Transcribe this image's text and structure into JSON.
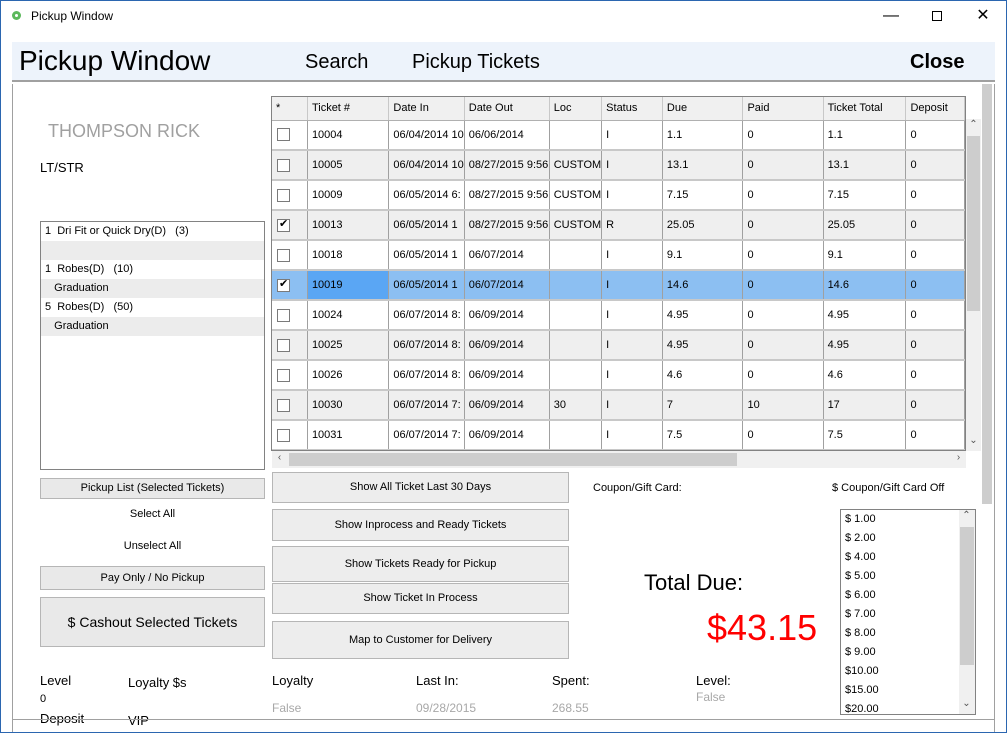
{
  "window": {
    "title": "Pickup Window",
    "controls": {
      "minimize": "—",
      "close": "✕"
    }
  },
  "header": {
    "title": "Pickup Window",
    "nav": {
      "search": "Search",
      "pickup_tickets": "Pickup Tickets",
      "close": "Close"
    }
  },
  "customer": {
    "name": "THOMPSON RICK",
    "type": "LT/STR"
  },
  "items": [
    {
      "text": "1  Dri Fit or Quick Dry(D)   (3)",
      "alt": false
    },
    {
      "text": "",
      "alt": true
    },
    {
      "text": "1  Robes(D)   (10)",
      "alt": false
    },
    {
      "text": "   Graduation",
      "alt": true
    },
    {
      "text": "5  Robes(D)   (50)",
      "alt": false
    },
    {
      "text": "   Graduation",
      "alt": true
    }
  ],
  "left_actions": {
    "pickup_list": "Pickup List (Selected Tickets)",
    "select_all": "Select All",
    "unselect_all": "Unselect All",
    "pay_only": "Pay Only / No Pickup",
    "cashout": "$ Cashout Selected Tickets"
  },
  "stats": {
    "level_label": "Level",
    "level_value": "0",
    "loyalty_dollars_label": "Loyalty $s",
    "deposit_label": "Deposit",
    "vip_label": "VIP",
    "loyalty_label": "Loyalty",
    "loyalty_value": "False",
    "last_in_label": "Last In:",
    "last_in_value": "09/28/2015",
    "spent_label": "Spent:",
    "spent_value": "268.55",
    "level2_label": "Level:",
    "level2_value": "False"
  },
  "tickets": {
    "columns": [
      "*",
      "Ticket #",
      "Date In",
      "Date Out",
      "Loc",
      "Status",
      "Due",
      "Paid",
      "Ticket Total",
      "Deposit"
    ],
    "rows": [
      {
        "checked": false,
        "ticket": "10004",
        "date_in": "06/04/2014 10",
        "date_out": "06/06/2014",
        "loc": "",
        "status": "I",
        "due": "1.1",
        "paid": "0",
        "total": "1.1",
        "deposit": "0"
      },
      {
        "checked": false,
        "ticket": "10005",
        "date_in": "06/04/2014 10",
        "date_out": "08/27/2015 9:56",
        "loc": "CUSTOM",
        "status": "I",
        "due": "13.1",
        "paid": "0",
        "total": "13.1",
        "deposit": "0"
      },
      {
        "checked": false,
        "ticket": "10009",
        "date_in": "06/05/2014 6:",
        "date_out": "08/27/2015 9:56",
        "loc": "CUSTOM",
        "status": "I",
        "due": "7.15",
        "paid": "0",
        "total": "7.15",
        "deposit": "0"
      },
      {
        "checked": true,
        "ticket": "10013",
        "date_in": "06/05/2014 1",
        "date_out": "08/27/2015 9:56",
        "loc": "CUSTOM",
        "status": "R",
        "due": "25.05",
        "paid": "0",
        "total": "25.05",
        "deposit": "0"
      },
      {
        "checked": false,
        "ticket": "10018",
        "date_in": "06/05/2014 1",
        "date_out": "06/07/2014",
        "loc": "",
        "status": "I",
        "due": "9.1",
        "paid": "0",
        "total": "9.1",
        "deposit": "0"
      },
      {
        "checked": true,
        "ticket": "10019",
        "date_in": "06/05/2014 1",
        "date_out": "06/07/2014",
        "loc": "",
        "status": "I",
        "due": "14.6",
        "paid": "0",
        "total": "14.6",
        "deposit": "0",
        "selected": true
      },
      {
        "checked": false,
        "ticket": "10024",
        "date_in": "06/07/2014 8:",
        "date_out": "06/09/2014",
        "loc": "",
        "status": "I",
        "due": "4.95",
        "paid": "0",
        "total": "4.95",
        "deposit": "0"
      },
      {
        "checked": false,
        "ticket": "10025",
        "date_in": "06/07/2014 8:",
        "date_out": "06/09/2014",
        "loc": "",
        "status": "I",
        "due": "4.95",
        "paid": "0",
        "total": "4.95",
        "deposit": "0"
      },
      {
        "checked": false,
        "ticket": "10026",
        "date_in": "06/07/2014 8:",
        "date_out": "06/09/2014",
        "loc": "",
        "status": "I",
        "due": "4.6",
        "paid": "0",
        "total": "4.6",
        "deposit": "0"
      },
      {
        "checked": false,
        "ticket": "10030",
        "date_in": "06/07/2014 7:",
        "date_out": "06/09/2014",
        "loc": "30",
        "status": "I",
        "due": "7",
        "paid": "10",
        "total": "17",
        "deposit": "0"
      },
      {
        "checked": false,
        "ticket": "10031",
        "date_in": "06/07/2014 7:",
        "date_out": "06/09/2014",
        "loc": "",
        "status": "I",
        "due": "7.5",
        "paid": "0",
        "total": "7.5",
        "deposit": "0"
      }
    ]
  },
  "filter_buttons": {
    "last30": "Show All Ticket Last 30 Days",
    "inprocess_ready": "Show Inprocess and Ready Tickets",
    "ready": "Show Tickets Ready for Pickup",
    "inprocess": "Show Ticket In Process",
    "map_delivery": "Map to Customer for Delivery"
  },
  "coupon": {
    "label": "Coupon/Gift Card:",
    "off_label": "$ Coupon/Gift Card Off",
    "options": [
      "$ 1.00",
      "$ 2.00",
      "$ 4.00",
      "$ 5.00",
      "$ 6.00",
      "$ 7.00",
      "$ 8.00",
      "$ 9.00",
      "$10.00",
      "$15.00",
      "$20.00"
    ]
  },
  "total": {
    "label": "Total Due:",
    "value": "$43.15",
    "color": "#ff0000"
  },
  "colors": {
    "header_bg": "#edf3fb",
    "selected_row": "#8cbff2",
    "window_border": "#2b66b0"
  }
}
